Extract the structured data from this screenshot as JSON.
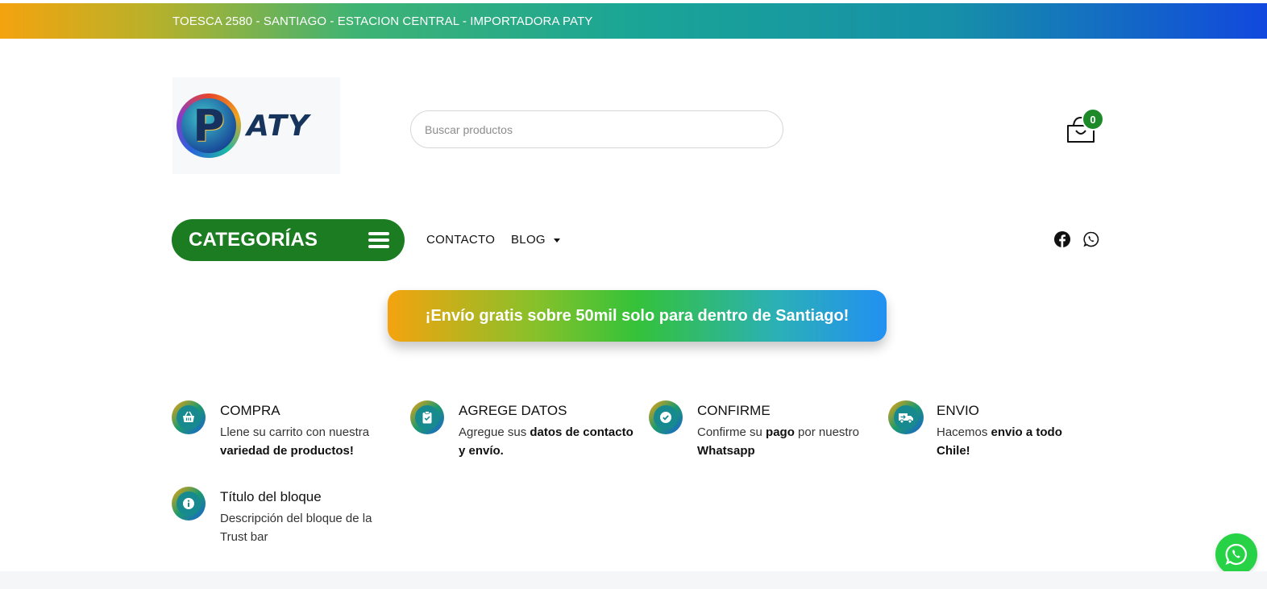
{
  "topbar": {
    "address": "TOESCA 2580 - SANTIAGO - ESTACION CENTRAL - IMPORTADORA PATY"
  },
  "logo": {
    "letter": "P",
    "text": "ATY",
    "alt": "PATY"
  },
  "search": {
    "placeholder": "Buscar productos"
  },
  "cart": {
    "count": "0"
  },
  "nav": {
    "categories_label": "CATEGORÍAS",
    "links": [
      "CONTACTO",
      "BLOG"
    ]
  },
  "social": {
    "icons": [
      "facebook-icon",
      "whatsapp-icon"
    ]
  },
  "promo": {
    "text": "¡Envío gratis sobre 50mil solo para dentro de Santiago!"
  },
  "trust": [
    {
      "icon": "basket-icon",
      "title": "COMPRA",
      "desc_plain": "Llene su carrito con nuestra ",
      "desc_bold": "variedad de productos!"
    },
    {
      "icon": "clipboard-check-icon",
      "title": "AGREGE DATOS",
      "desc_plain": "Agregue sus ",
      "desc_bold": "datos de contacto y envío."
    },
    {
      "icon": "check-circle-icon",
      "title": "CONFIRME",
      "desc_plain1": "Confirme su ",
      "desc_bold1": "pago",
      "desc_plain2": " por nuestro ",
      "desc_bold2": "Whatsapp"
    },
    {
      "icon": "truck-icon",
      "title": "ENVIO",
      "desc_plain": "Hacemos ",
      "desc_bold": "envio a todo Chile!"
    },
    {
      "icon": "info-icon",
      "title": "Título del bloque",
      "desc_plain": "Descripción del bloque de la Trust bar"
    }
  ],
  "colors": {
    "brand_green": "#1c7c22",
    "whatsapp_green": "#27d246",
    "badge_green": "#1d8a2a"
  }
}
